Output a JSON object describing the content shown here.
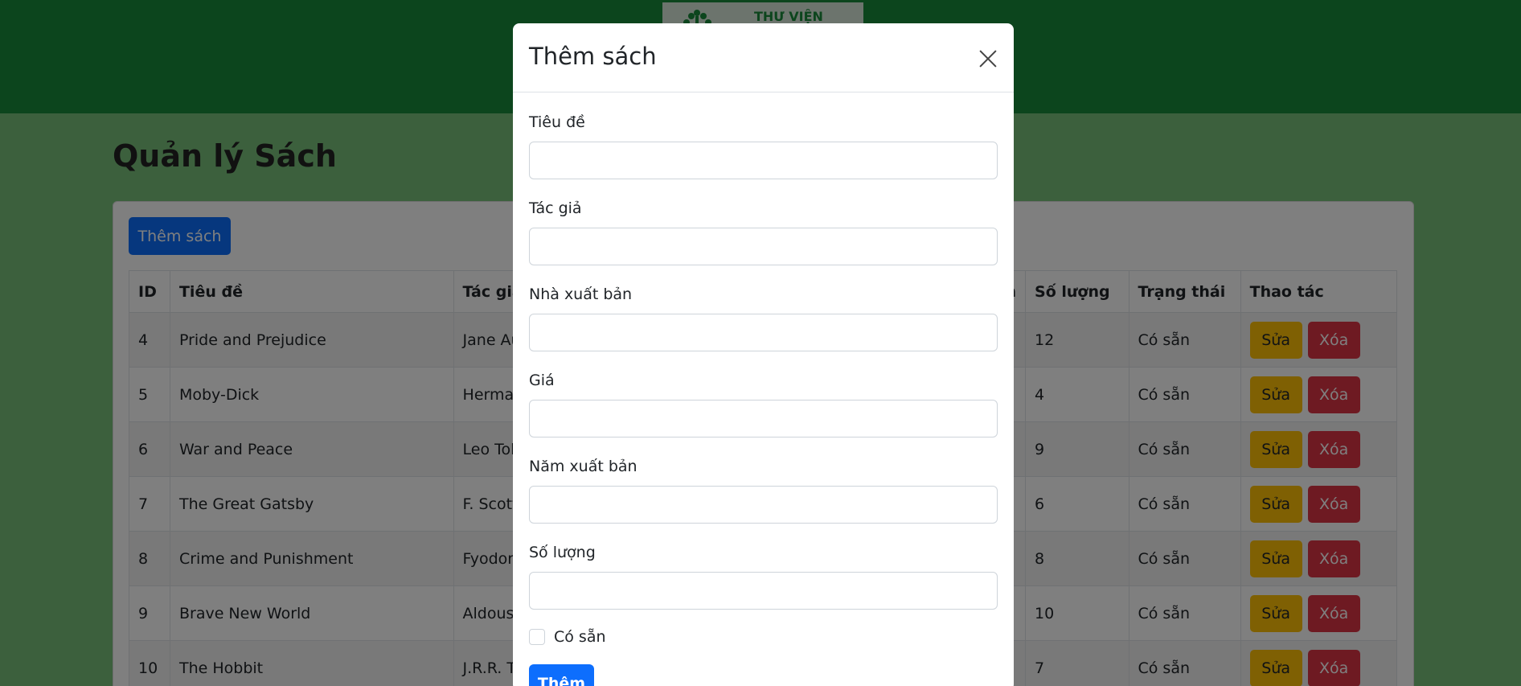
{
  "header": {
    "logo_text": "THƯ VIỆN",
    "colors": {
      "background": "#198a3a",
      "page_background": "#79c17a"
    }
  },
  "page": {
    "title": "Quản lý Sách",
    "add_button_label": "Thêm sách"
  },
  "table": {
    "columns": [
      "ID",
      "Tiêu đề",
      "Tác giả",
      "",
      "",
      "",
      "n",
      "Số lượng",
      "Trạng thái",
      "Thao tác"
    ],
    "rows": [
      {
        "id": "4",
        "title": "Pride and Prejudice",
        "author": "Jane Auste",
        "quantity": "12",
        "status": "Có sẵn"
      },
      {
        "id": "5",
        "title": "Moby-Dick",
        "author": "Herman M",
        "quantity": "4",
        "status": "Có sẵn"
      },
      {
        "id": "6",
        "title": "War and Peace",
        "author": "Leo Tolsto",
        "quantity": "9",
        "status": "Có sẵn"
      },
      {
        "id": "7",
        "title": "The Great Gatsby",
        "author": "F. Scott Fit",
        "quantity": "6",
        "status": "Có sẵn"
      },
      {
        "id": "8",
        "title": "Crime and Punishment",
        "author": "Fyodor Do",
        "quantity": "8",
        "status": "Có sẵn"
      },
      {
        "id": "9",
        "title": "Brave New World",
        "author": "Aldous Hu",
        "quantity": "10",
        "status": "Có sẵn"
      },
      {
        "id": "10",
        "title": "The Hobbit",
        "author": "J.R.R. Tolki",
        "quantity": "7",
        "status": "Có sẵn"
      }
    ],
    "edit_label": "Sửa",
    "delete_label": "Xóa",
    "colors": {
      "edit": "#ffc107",
      "delete": "#dc3545"
    }
  },
  "modal": {
    "title": "Thêm sách",
    "close_icon": "close-icon",
    "fields": [
      {
        "label": "Tiêu đề",
        "value": ""
      },
      {
        "label": "Tác giả",
        "value": ""
      },
      {
        "label": "Nhà xuất bản",
        "value": ""
      },
      {
        "label": "Giá",
        "value": ""
      },
      {
        "label": "Năm xuất bản",
        "value": ""
      },
      {
        "label": "Số lượng",
        "value": ""
      }
    ],
    "checkbox": {
      "label": "Có sẵn",
      "checked": false
    },
    "submit_label": "Thêm",
    "colors": {
      "primary": "#0d6efd"
    }
  }
}
